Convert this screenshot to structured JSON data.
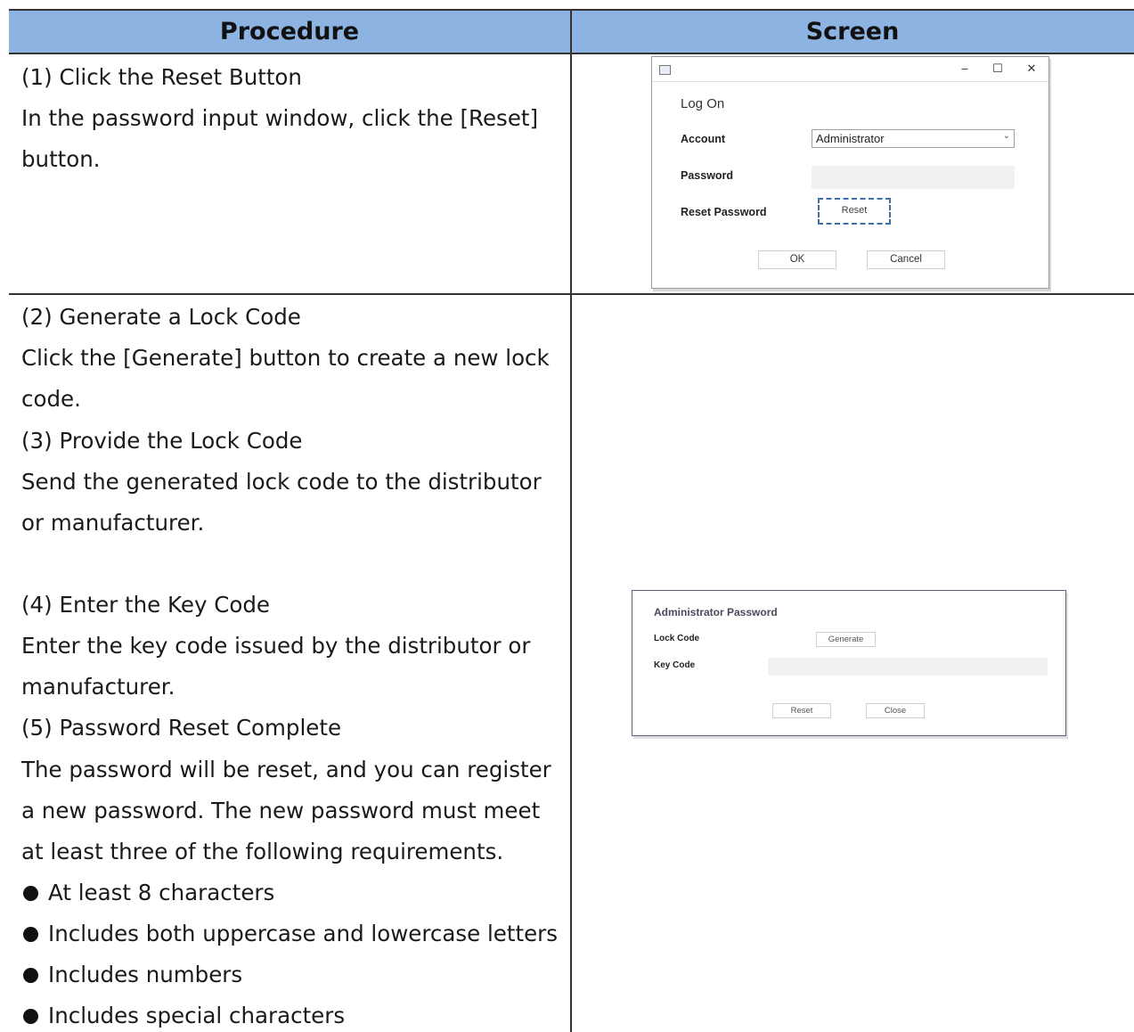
{
  "table": {
    "header_procedure": "Procedure",
    "header_screen": "Screen"
  },
  "procedure": {
    "row1": [
      "(1) Click the Reset Button",
      "In the password input window, click the [Reset]",
      "button."
    ],
    "row2": [
      "(2) Generate a Lock Code",
      "Click the [Generate] button to create a new lock",
      "code.",
      "(3) Provide the Lock Code",
      "Send the generated lock code to the distributor",
      "or manufacturer.",
      "(4) Enter the Key Code",
      "Enter the key code issued by the distributor or",
      "manufacturer.",
      "(5) Password Reset Complete",
      "The password will be reset, and you can register",
      "a new password. The new password must meet",
      "at least three of the following requirements."
    ],
    "bullets": [
      "At least 8 characters",
      "Includes both uppercase and lowercase letters",
      "Includes numbers",
      "Includes special characters"
    ]
  },
  "logon_dialog": {
    "minimize": "–",
    "maximize": "☐",
    "close": "✕",
    "heading": "Log On",
    "account_label": "Account",
    "account_value": "Administrator",
    "password_label": "Password",
    "reset_password_label": "Reset Password",
    "reset_button": "Reset",
    "ok_button": "OK",
    "cancel_button": "Cancel",
    "highlight_color": "#3b6fa8"
  },
  "admin_dialog": {
    "heading": "Administrator Password",
    "lock_code_label": "Lock Code",
    "generate_button": "Generate",
    "key_code_label": "Key Code",
    "reset_button": "Reset",
    "close_button": "Close"
  },
  "colors": {
    "header_bg": "#8db3e2",
    "rule": "#333333"
  }
}
